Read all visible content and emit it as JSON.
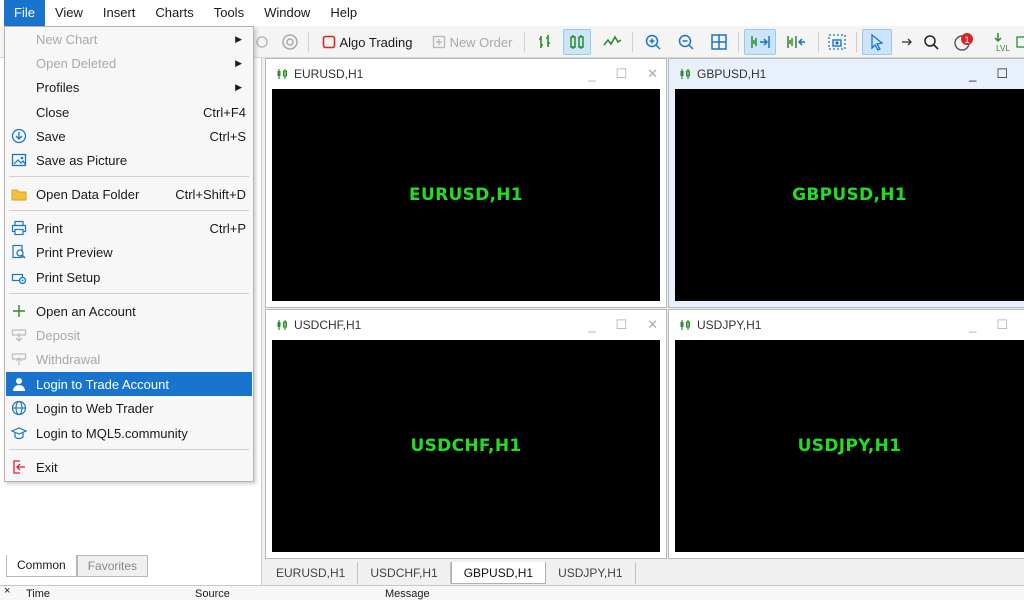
{
  "menubar": [
    "File",
    "View",
    "Insert",
    "Charts",
    "Tools",
    "Window",
    "Help"
  ],
  "toolbar": {
    "algo_trading": "Algo Trading",
    "new_order": "New Order",
    "alerts_badge": "1",
    "lvl_label": "LVL"
  },
  "file_menu": {
    "new_chart": "New Chart",
    "open_deleted": "Open Deleted",
    "profiles": "Profiles",
    "close": "Close",
    "close_sc": "Ctrl+F4",
    "save": "Save",
    "save_sc": "Ctrl+S",
    "save_as_picture": "Save as Picture",
    "open_data_folder": "Open Data Folder",
    "open_data_folder_sc": "Ctrl+Shift+D",
    "print": "Print",
    "print_sc": "Ctrl+P",
    "print_preview": "Print Preview",
    "print_setup": "Print Setup",
    "open_account": "Open an Account",
    "deposit": "Deposit",
    "withdrawal": "Withdrawal",
    "login_trade": "Login to Trade Account",
    "login_web": "Login to Web Trader",
    "login_mql5": "Login to MQL5.community",
    "exit": "Exit"
  },
  "charts": [
    {
      "title": "EURUSD,H1",
      "label": "EURUSD,H1"
    },
    {
      "title": "GBPUSD,H1",
      "label": "GBPUSD,H1"
    },
    {
      "title": "USDCHF,H1",
      "label": "USDCHF,H1"
    },
    {
      "title": "USDJPY,H1",
      "label": "USDJPY,H1"
    }
  ],
  "chart_tabs": [
    "EURUSD,H1",
    "USDCHF,H1",
    "GBPUSD,H1",
    "USDJPY,H1"
  ],
  "navigator_tabs": [
    "Common",
    "Favorites"
  ],
  "terminal": {
    "close": "×",
    "cols": [
      "Time",
      "Source",
      "Message"
    ]
  },
  "colors": {
    "accent": "#1874cd",
    "chart_bg": "#000000",
    "chart_label": "#22dd22"
  }
}
